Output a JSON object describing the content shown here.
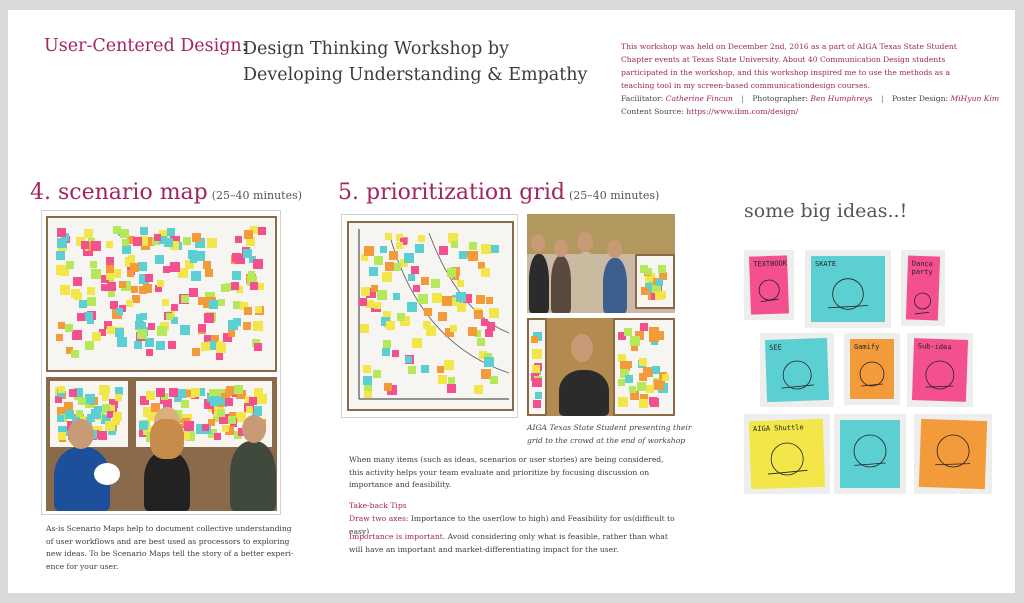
{
  "header": {
    "title_accent": "User-Centered Design",
    "title_colon": ":",
    "title_main": "Design Thinking Workshop by Developing Understanding & Empathy",
    "intro": "This workshop was held on December 2nd, 2016  as a part of AIGA Texas State Student Chapter events at Texas State University. About 40 Communication Design students participated in the workshop, and this workshop inspired me to use the methods as a teaching tool in my screen-based communicationdesign courses.",
    "facilitator_label": "Facilitator:",
    "facilitator": "Catherine Fincun",
    "photographer_label": "Photographer:",
    "photographer": "Ben Humphreys",
    "poster_design_label": "Poster Design:",
    "poster_design": "MiHyun Kim",
    "separator": "|",
    "content_source_label": "Content Source:",
    "content_source": "https://www.ibm.com/design/"
  },
  "section4": {
    "title": "4. scenario map",
    "duration": "(25–40 minutes)",
    "caption": "As-is Scenario Maps help to document collective understanding of user workflows and are best used as processors to exploring new ideas. To be Scenario Maps tell the story of a better experi- ence for your user."
  },
  "section5": {
    "title": "5. prioritization grid",
    "duration": "(25–40 minutes)",
    "photo_caption": "AIGA Texas State Student presenting their grid to the crowd at the end of workshop",
    "body": "When many items (such as ideas, scenarios or user stories) are being considered, this activity helps your team evaluate and prioritize by focusing discussion on importance and feasibility.",
    "tips_heading": "Take-back Tips",
    "tip1_label": "Draw two axes:",
    "tip1_text": " Importance to the user(low to high) and Feasibility for us(difficult to easy)",
    "tip2_label": "Importance is important.",
    "tip2_text": " Avoid considering only what is feasible, rather than what will have an important and market-differentiating impact for the user."
  },
  "ideas": {
    "title": "some big ideas..!",
    "notes": [
      "TEXTBOOK",
      "SKATE",
      "Dance party",
      "SEE",
      "Gamify",
      "Sub-idea",
      "AIGA Shuttle",
      "",
      ""
    ]
  },
  "colors": {
    "accent": "#a3245f",
    "text": "#3c3c3c",
    "note_pink": "#f4508f",
    "note_yellow": "#f2e64a",
    "note_green": "#b5e85a",
    "note_cyan": "#5ccfd3",
    "note_orange": "#f39b3a"
  }
}
